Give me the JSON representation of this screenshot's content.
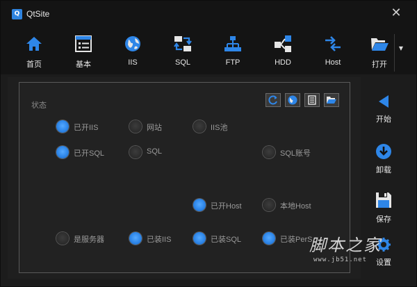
{
  "app": {
    "title": "QtSite",
    "icon_glyph": "Q",
    "close_glyph": "✕"
  },
  "toolbar": {
    "items": [
      {
        "label": "首页",
        "icon": "home-icon"
      },
      {
        "label": "基本",
        "icon": "basic-settings-icon"
      },
      {
        "label": "IIS",
        "icon": "globe-icon"
      },
      {
        "label": "SQL",
        "icon": "database-exchange-icon"
      },
      {
        "label": "FTP",
        "icon": "network-icon"
      },
      {
        "label": "HDD",
        "icon": "disk-icon"
      },
      {
        "label": "Host",
        "icon": "host-arrows-icon"
      },
      {
        "label": "打开",
        "icon": "folder-open-icon"
      }
    ],
    "more_glyph": "▼"
  },
  "status": {
    "title": "状态",
    "buttons": [
      "refresh-icon",
      "globe-icon",
      "document-icon",
      "folder-icon"
    ],
    "indicators": [
      {
        "label": "已开IIS",
        "on": true
      },
      {
        "label": "网站",
        "on": false
      },
      {
        "label": "IIS池",
        "on": false
      },
      {
        "label": "已开SQL",
        "on": true
      },
      {
        "label": "SQL",
        "on": false
      },
      {
        "label": "SQL账号",
        "on": false
      },
      {
        "label": "已开Host",
        "on": true
      },
      {
        "label": "本地Host",
        "on": false
      },
      {
        "label": "是服务器",
        "on": false
      },
      {
        "label": "已装IIS",
        "on": true
      },
      {
        "label": "已装SQL",
        "on": true
      },
      {
        "label": "已装PerS",
        "on": true
      }
    ]
  },
  "side": {
    "start": "开始",
    "uninstall": "卸载",
    "save": "保存",
    "settings": "设置"
  },
  "watermark": {
    "text": "脚本之家",
    "url": "www.jb51.net"
  },
  "colors": {
    "accent": "#2e86e8",
    "background": "#1c1c1c",
    "titlebar": "#141414"
  }
}
